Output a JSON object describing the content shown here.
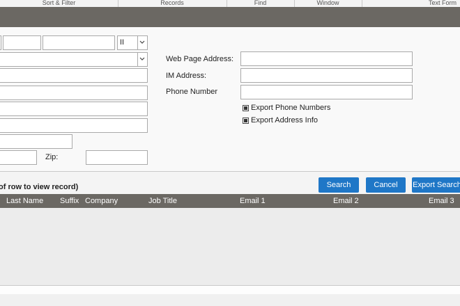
{
  "ribbon": {
    "groups": [
      "Sort & Filter",
      "Records",
      "Find",
      "Window",
      "Text Form"
    ]
  },
  "form": {
    "name_suffix_value": "II",
    "labels": {
      "web_page": "Web Page Address:",
      "im_address": "IM Address:",
      "phone_number": "Phone Number",
      "zip": "Zip:"
    },
    "checkboxes": {
      "export_phone": "Export Phone Numbers",
      "export_address": "Export Address Info"
    }
  },
  "actions": {
    "hint": "of row to view record)",
    "search": "Search",
    "cancel": "Cancel",
    "export_search": "Export Search"
  },
  "table": {
    "columns": [
      "Last Name",
      "Suffix",
      "Company",
      "Job Title",
      "Email 1",
      "Email 2",
      "Email 3"
    ]
  }
}
